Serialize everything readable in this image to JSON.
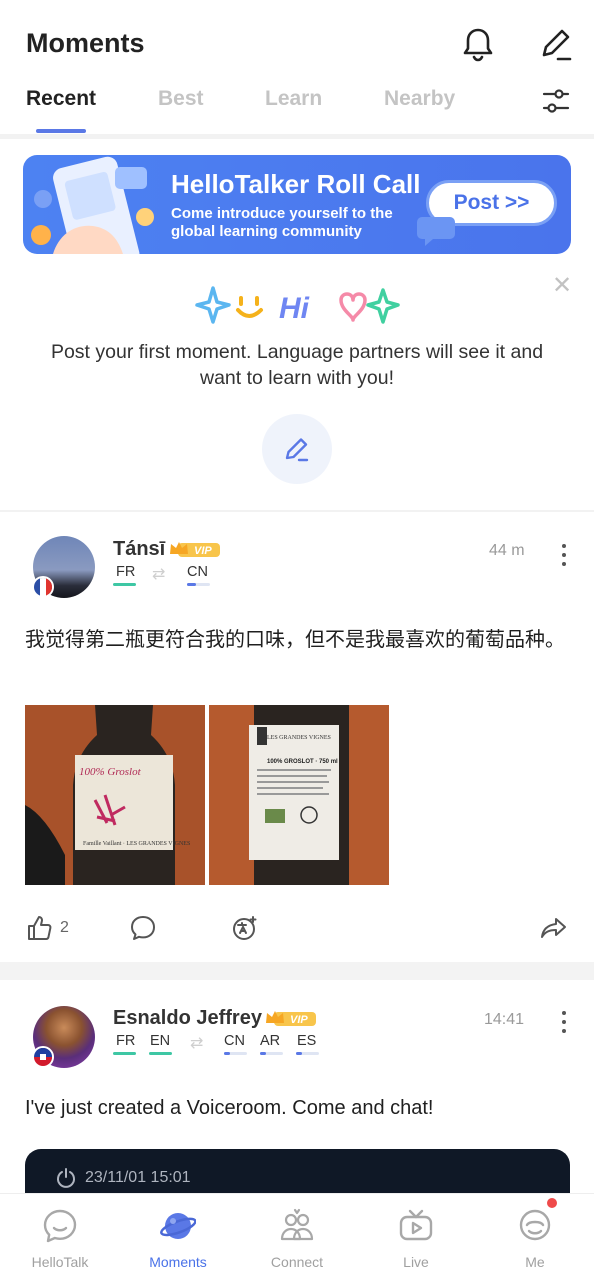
{
  "header": {
    "title": "Moments",
    "tabs": [
      {
        "label": "Recent",
        "active": true
      },
      {
        "label": "Best",
        "active": false
      },
      {
        "label": "Learn",
        "active": false
      },
      {
        "label": "Nearby",
        "active": false
      }
    ],
    "icons": [
      "bell-icon",
      "compose-icon",
      "filter-icon"
    ]
  },
  "banner": {
    "title": "HelloTalker Roll Call",
    "subtitle": "Come introduce yourself to the global learning community",
    "button_label": "Post >>"
  },
  "prompt": {
    "hi_text": "Hi",
    "message": "Post your first moment. Language partners will see it and want to learn with you!"
  },
  "posts": [
    {
      "username": "Tánsī",
      "badge": "VIP",
      "time": "44 m",
      "native_langs": [
        "FR"
      ],
      "learning_langs": [
        "CN"
      ],
      "text": "我觉得第二瓶更符合我的口味，但不是我最喜欢的葡萄品种。",
      "like_count": "2",
      "photos": [
        {
          "label_text": "100% Groslot",
          "footer": "Famille Vaillant · LES GRANDES VIGNES"
        },
        {
          "label_text": "LES GRANDES VIGNES",
          "footer": "100% GROSLOT · 750 ml"
        }
      ]
    },
    {
      "username": "Esnaldo Jeffrey",
      "badge": "VIP",
      "time": "14:41",
      "native_langs": [
        "FR",
        "EN"
      ],
      "learning_langs": [
        "CN",
        "AR",
        "ES"
      ],
      "text": "I've just created a Voiceroom. Come and chat!",
      "voiceroom_time": "23/11/01 15:01"
    }
  ],
  "bottom_nav": [
    {
      "label": "HelloTalk",
      "icon": "chat-bubble-icon",
      "active": false
    },
    {
      "label": "Moments",
      "icon": "planet-icon",
      "active": true
    },
    {
      "label": "Connect",
      "icon": "people-icon",
      "active": false
    },
    {
      "label": "Live",
      "icon": "tv-icon",
      "active": false
    },
    {
      "label": "Me",
      "icon": "profile-face-icon",
      "active": false,
      "notification_dot": true
    }
  ],
  "colors": {
    "accent": "#4a72e8",
    "native_bar": "#3ec7a4",
    "learning_bar": "#5a78e6"
  }
}
